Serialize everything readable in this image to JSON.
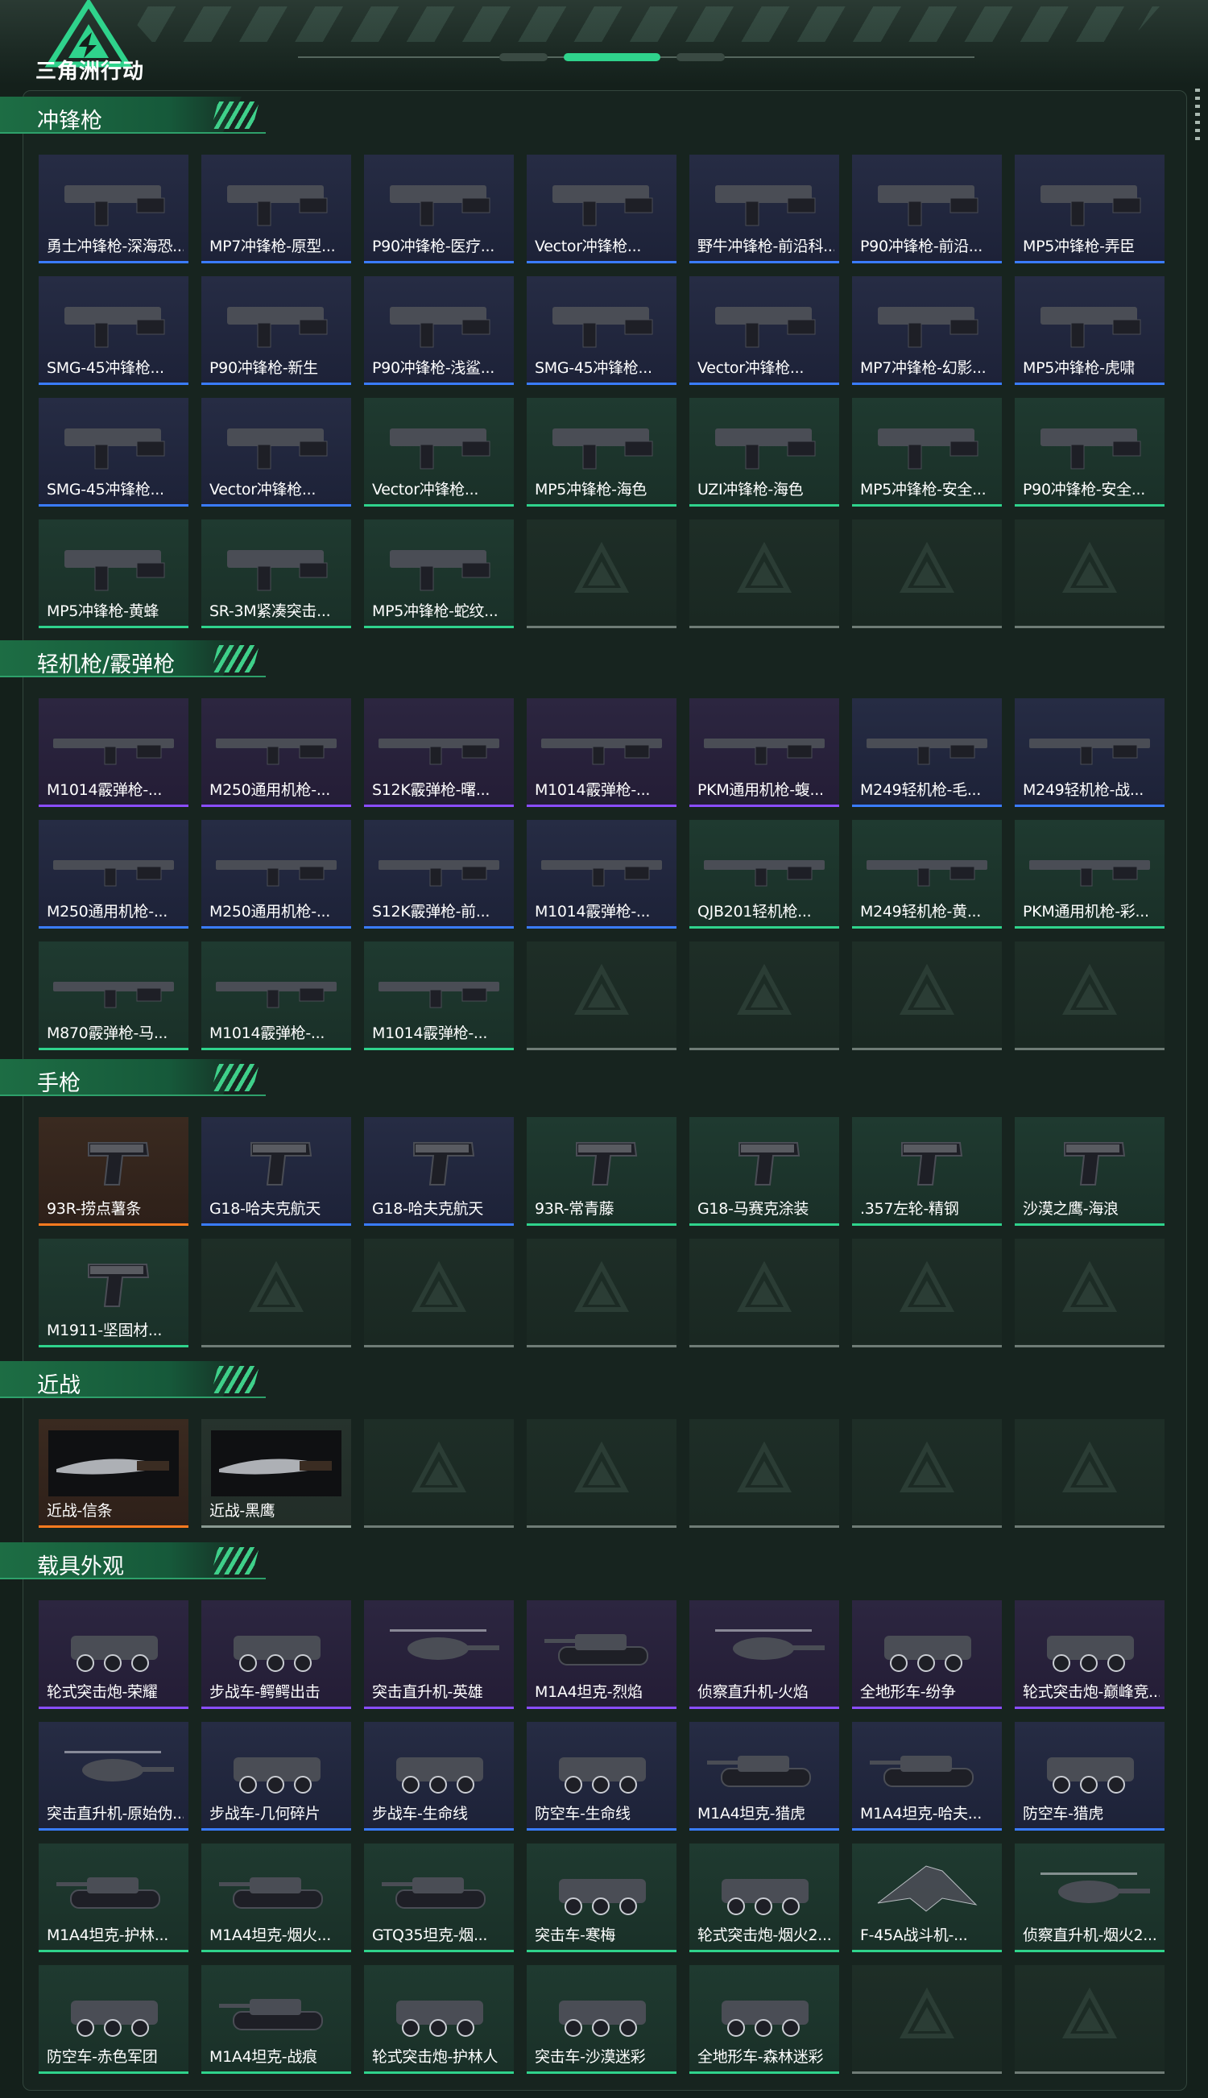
{
  "header": {
    "logo_text": "三角洲行动",
    "menu_icon": "vertical-dots-icon"
  },
  "colors": {
    "accent": "#2fd38c",
    "section_band": "#1d6d44",
    "rarity_blue": "#3a7cff",
    "rarity_purple": "#8a4dff",
    "rarity_green": "#2fd38c",
    "rarity_orange": "#ff7a1f",
    "empty": "#6f7c76"
  },
  "sections": [
    {
      "title": "冲锋枪",
      "items": [
        {
          "label": "勇士冲锋枪-深海恐...",
          "rarity": "blue",
          "icon": "smg-icon"
        },
        {
          "label": "MP7冲锋枪-原型...",
          "rarity": "blue",
          "icon": "smg-icon"
        },
        {
          "label": "P90冲锋枪-医疗...",
          "rarity": "blue",
          "icon": "smg-icon"
        },
        {
          "label": "Vector冲锋枪...",
          "rarity": "blue",
          "icon": "smg-icon"
        },
        {
          "label": "野牛冲锋枪-前沿科...",
          "rarity": "blue",
          "icon": "smg-icon"
        },
        {
          "label": "P90冲锋枪-前沿...",
          "rarity": "blue",
          "icon": "smg-icon"
        },
        {
          "label": "MP5冲锋枪-弄臣",
          "rarity": "blue",
          "icon": "smg-icon"
        },
        {
          "label": "SMG-45冲锋枪...",
          "rarity": "blue",
          "icon": "smg-icon"
        },
        {
          "label": "P90冲锋枪-新生",
          "rarity": "blue",
          "icon": "smg-icon"
        },
        {
          "label": "P90冲锋枪-浅鲨...",
          "rarity": "blue",
          "icon": "smg-icon"
        },
        {
          "label": "SMG-45冲锋枪...",
          "rarity": "blue",
          "icon": "smg-icon"
        },
        {
          "label": "Vector冲锋枪...",
          "rarity": "blue",
          "icon": "smg-icon"
        },
        {
          "label": "MP7冲锋枪-幻影...",
          "rarity": "blue",
          "icon": "smg-icon"
        },
        {
          "label": "MP5冲锋枪-虎啸",
          "rarity": "blue",
          "icon": "smg-icon"
        },
        {
          "label": "SMG-45冲锋枪...",
          "rarity": "blue",
          "icon": "smg-icon"
        },
        {
          "label": "Vector冲锋枪...",
          "rarity": "blue",
          "icon": "smg-icon"
        },
        {
          "label": "Vector冲锋枪...",
          "rarity": "green",
          "icon": "smg-icon"
        },
        {
          "label": "MP5冲锋枪-海色",
          "rarity": "green",
          "icon": "smg-icon"
        },
        {
          "label": "UZI冲锋枪-海色",
          "rarity": "green",
          "icon": "smg-icon"
        },
        {
          "label": "MP5冲锋枪-安全...",
          "rarity": "green",
          "icon": "smg-icon"
        },
        {
          "label": "P90冲锋枪-安全...",
          "rarity": "green",
          "icon": "smg-icon"
        },
        {
          "label": "MP5冲锋枪-黄蜂",
          "rarity": "green",
          "icon": "smg-icon"
        },
        {
          "label": "SR-3M紧凑突击...",
          "rarity": "green",
          "icon": "smg-icon"
        },
        {
          "label": "MP5冲锋枪-蛇纹...",
          "rarity": "green",
          "icon": "smg-icon"
        },
        {
          "label": "",
          "rarity": "empty",
          "icon": "empty-slot-icon"
        },
        {
          "label": "",
          "rarity": "empty",
          "icon": "empty-slot-icon"
        },
        {
          "label": "",
          "rarity": "empty",
          "icon": "empty-slot-icon"
        },
        {
          "label": "",
          "rarity": "empty",
          "icon": "empty-slot-icon"
        }
      ]
    },
    {
      "title": "轻机枪/霰弹枪",
      "items": [
        {
          "label": "M1014霰弹枪-...",
          "rarity": "purple",
          "icon": "rifle-icon"
        },
        {
          "label": "M250通用机枪-...",
          "rarity": "purple",
          "icon": "rifle-icon"
        },
        {
          "label": "S12K霰弹枪-曙...",
          "rarity": "purple",
          "icon": "rifle-icon"
        },
        {
          "label": "M1014霰弹枪-...",
          "rarity": "purple",
          "icon": "rifle-icon"
        },
        {
          "label": "PKM通用机枪-蝮...",
          "rarity": "purple",
          "icon": "rifle-icon"
        },
        {
          "label": "M249轻机枪-毛...",
          "rarity": "blue",
          "icon": "rifle-icon"
        },
        {
          "label": "M249轻机枪-战...",
          "rarity": "blue",
          "icon": "rifle-icon"
        },
        {
          "label": "M250通用机枪-...",
          "rarity": "blue",
          "icon": "rifle-icon"
        },
        {
          "label": "M250通用机枪-...",
          "rarity": "blue",
          "icon": "rifle-icon"
        },
        {
          "label": "S12K霰弹枪-前...",
          "rarity": "blue",
          "icon": "rifle-icon"
        },
        {
          "label": "M1014霰弹枪-...",
          "rarity": "blue",
          "icon": "rifle-icon"
        },
        {
          "label": "QJB201轻机枪...",
          "rarity": "green",
          "icon": "rifle-icon"
        },
        {
          "label": "M249轻机枪-黄...",
          "rarity": "green",
          "icon": "rifle-icon"
        },
        {
          "label": "PKM通用机枪-彩...",
          "rarity": "green",
          "icon": "rifle-icon"
        },
        {
          "label": "M870霰弹枪-马...",
          "rarity": "green",
          "icon": "rifle-icon"
        },
        {
          "label": "M1014霰弹枪-...",
          "rarity": "green",
          "icon": "rifle-icon"
        },
        {
          "label": "M1014霰弹枪-...",
          "rarity": "green",
          "icon": "rifle-icon"
        },
        {
          "label": "",
          "rarity": "empty",
          "icon": "empty-slot-icon"
        },
        {
          "label": "",
          "rarity": "empty",
          "icon": "empty-slot-icon"
        },
        {
          "label": "",
          "rarity": "empty",
          "icon": "empty-slot-icon"
        },
        {
          "label": "",
          "rarity": "empty",
          "icon": "empty-slot-icon"
        }
      ]
    },
    {
      "title": "手枪",
      "items": [
        {
          "label": "93R-捞点薯条",
          "rarity": "orange",
          "icon": "pistol-icon"
        },
        {
          "label": "G18-哈夫克航天",
          "rarity": "blue",
          "icon": "pistol-icon"
        },
        {
          "label": "G18-哈夫克航天",
          "rarity": "blue",
          "icon": "pistol-icon"
        },
        {
          "label": "93R-常青藤",
          "rarity": "green",
          "icon": "pistol-icon"
        },
        {
          "label": "G18-马赛克涂装",
          "rarity": "green",
          "icon": "pistol-icon"
        },
        {
          "label": ".357左轮-精钢",
          "rarity": "green",
          "icon": "pistol-icon"
        },
        {
          "label": "沙漠之鹰-海浪",
          "rarity": "green",
          "icon": "pistol-icon"
        },
        {
          "label": "M1911-坚固材...",
          "rarity": "green",
          "icon": "pistol-icon"
        },
        {
          "label": "",
          "rarity": "empty",
          "icon": "empty-slot-icon"
        },
        {
          "label": "",
          "rarity": "empty",
          "icon": "empty-slot-icon"
        },
        {
          "label": "",
          "rarity": "empty",
          "icon": "empty-slot-icon"
        },
        {
          "label": "",
          "rarity": "empty",
          "icon": "empty-slot-icon"
        },
        {
          "label": "",
          "rarity": "empty",
          "icon": "empty-slot-icon"
        },
        {
          "label": "",
          "rarity": "empty",
          "icon": "empty-slot-icon"
        }
      ]
    },
    {
      "title": "近战",
      "items": [
        {
          "label": "近战-信条",
          "rarity": "orange",
          "icon": "knife-icon"
        },
        {
          "label": "近战-黑鹰",
          "rarity": "gray",
          "icon": "knife-icon"
        },
        {
          "label": "",
          "rarity": "empty",
          "icon": "empty-slot-icon"
        },
        {
          "label": "",
          "rarity": "empty",
          "icon": "empty-slot-icon"
        },
        {
          "label": "",
          "rarity": "empty",
          "icon": "empty-slot-icon"
        },
        {
          "label": "",
          "rarity": "empty",
          "icon": "empty-slot-icon"
        },
        {
          "label": "",
          "rarity": "empty",
          "icon": "empty-slot-icon"
        }
      ]
    },
    {
      "title": "载具外观",
      "items": [
        {
          "label": "轮式突击炮-荣耀",
          "rarity": "purple",
          "icon": "vehicle-icon"
        },
        {
          "label": "步战车-鳄鳄出击",
          "rarity": "purple",
          "icon": "vehicle-icon"
        },
        {
          "label": "突击直升机-英雄",
          "rarity": "purple",
          "icon": "helicopter-icon"
        },
        {
          "label": "M1A4坦克-烈焰",
          "rarity": "purple",
          "icon": "tank-icon"
        },
        {
          "label": "侦察直升机-火焰",
          "rarity": "purple",
          "icon": "helicopter-icon"
        },
        {
          "label": "全地形车-纷争",
          "rarity": "purple",
          "icon": "vehicle-icon"
        },
        {
          "label": "轮式突击炮-巅峰竞...",
          "rarity": "purple",
          "icon": "vehicle-icon"
        },
        {
          "label": "突击直升机-原始伪...",
          "rarity": "blue",
          "icon": "helicopter-icon"
        },
        {
          "label": "步战车-几何碎片",
          "rarity": "blue",
          "icon": "vehicle-icon"
        },
        {
          "label": "步战车-生命线",
          "rarity": "blue",
          "icon": "vehicle-icon"
        },
        {
          "label": "防空车-生命线",
          "rarity": "blue",
          "icon": "vehicle-icon"
        },
        {
          "label": "M1A4坦克-猎虎",
          "rarity": "blue",
          "icon": "tank-icon"
        },
        {
          "label": "M1A4坦克-哈夫...",
          "rarity": "blue",
          "icon": "tank-icon"
        },
        {
          "label": "防空车-猎虎",
          "rarity": "blue",
          "icon": "vehicle-icon"
        },
        {
          "label": "M1A4坦克-护林...",
          "rarity": "green",
          "icon": "tank-icon"
        },
        {
          "label": "M1A4坦克-烟火...",
          "rarity": "green",
          "icon": "tank-icon"
        },
        {
          "label": "GTQ35坦克-烟...",
          "rarity": "green",
          "icon": "tank-icon"
        },
        {
          "label": "突击车-寒梅",
          "rarity": "green",
          "icon": "vehicle-icon"
        },
        {
          "label": "轮式突击炮-烟火2...",
          "rarity": "green",
          "icon": "vehicle-icon"
        },
        {
          "label": "F-45A战斗机-...",
          "rarity": "green",
          "icon": "jet-icon"
        },
        {
          "label": "侦察直升机-烟火2...",
          "rarity": "green",
          "icon": "helicopter-icon"
        },
        {
          "label": "防空车-赤色军团",
          "rarity": "green",
          "icon": "vehicle-icon"
        },
        {
          "label": "M1A4坦克-战痕",
          "rarity": "green",
          "icon": "tank-icon"
        },
        {
          "label": "轮式突击炮-护林人",
          "rarity": "green",
          "icon": "vehicle-icon"
        },
        {
          "label": "突击车-沙漠迷彩",
          "rarity": "green",
          "icon": "vehicle-icon"
        },
        {
          "label": "全地形车-森林迷彩",
          "rarity": "green",
          "icon": "vehicle-icon"
        },
        {
          "label": "",
          "rarity": "empty",
          "icon": "empty-slot-icon"
        },
        {
          "label": "",
          "rarity": "empty",
          "icon": "empty-slot-icon"
        }
      ]
    }
  ]
}
